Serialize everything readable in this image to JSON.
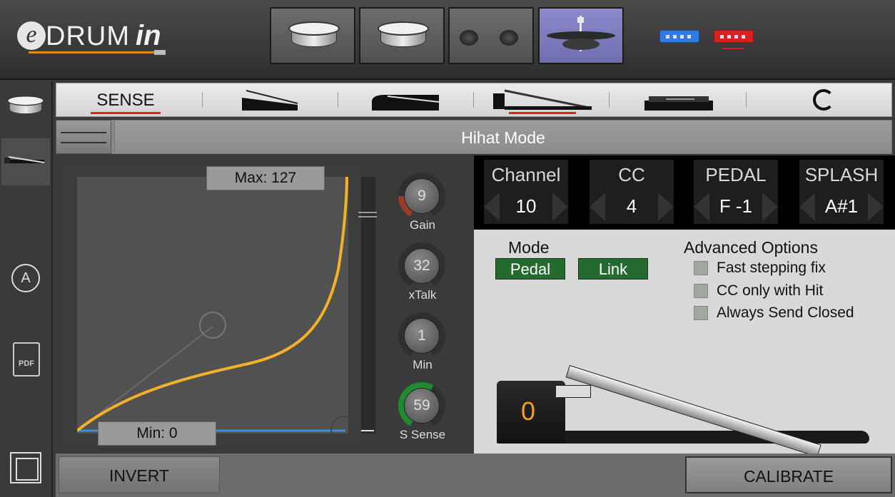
{
  "app": {
    "logo_e": "e",
    "logo_drum": "DRUM",
    "logo_in": "in"
  },
  "header": {
    "pads": [
      {
        "name": "pad-snare-1",
        "icon": "drum-pad-icon"
      },
      {
        "name": "pad-snare-2",
        "icon": "drum-pad-icon"
      },
      {
        "name": "pad-cymbal-pair",
        "icon": "cymbal-dots-icon"
      },
      {
        "name": "pad-hihat",
        "icon": "hihat-icon",
        "active": true
      }
    ],
    "colors": {
      "active_pad": "#7f7fc0",
      "jack_blue": "#2f7be0",
      "jack_red": "#d82020"
    }
  },
  "sidebar": {
    "pdf_label": "PDF",
    "a_label": "A"
  },
  "tabs": {
    "sense_label": "SENSE"
  },
  "modebar": {
    "title": "Hihat Mode"
  },
  "curve": {
    "max_label": "Max: 127",
    "min_label": "Min: 0",
    "colors": {
      "curve": "#f3b12a",
      "baseline": "#3d8fd6"
    }
  },
  "knobs": [
    {
      "value": "9",
      "label": "Gain",
      "arc_color": "#9a3b2a"
    },
    {
      "value": "32",
      "label": "xTalk",
      "arc_color": "#2f2f2f"
    },
    {
      "value": "1",
      "label": "Min",
      "arc_color": "#2f2f2f"
    },
    {
      "value": "59",
      "label": "S Sense",
      "arc_color": "#1f8a2f"
    }
  ],
  "params": [
    {
      "title": "Channel",
      "value": "10"
    },
    {
      "title": "CC",
      "value": "4"
    },
    {
      "title": "PEDAL",
      "value": "F -1"
    },
    {
      "title": "SPLASH",
      "value": "A#1"
    }
  ],
  "mode": {
    "title": "Mode",
    "pedal_button": "Pedal",
    "link_button": "Link"
  },
  "advanced": {
    "title": "Advanced Options",
    "options": [
      "Fast stepping fix",
      "CC only with Hit",
      "Always Send Closed"
    ]
  },
  "pedal": {
    "value": "0",
    "value_color": "#f0a020"
  },
  "bottom": {
    "invert_label": "INVERT",
    "calibrate_label": "CALIBRATE"
  }
}
